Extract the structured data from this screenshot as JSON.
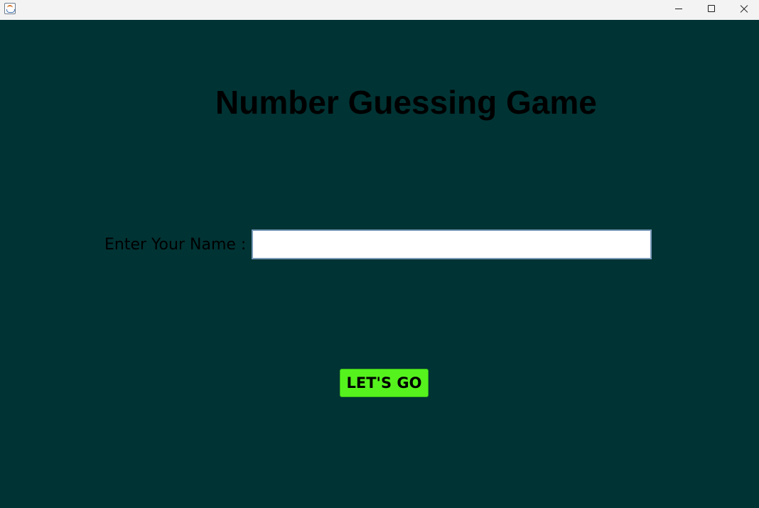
{
  "window": {
    "icon": "java-app-icon",
    "controls": {
      "minimize_icon": "minimize-icon",
      "maximize_icon": "maximize-icon",
      "close_icon": "close-icon"
    }
  },
  "main": {
    "title": "Number Guessing Game",
    "name_label": "Enter Your Name :",
    "name_input_value": "",
    "name_input_placeholder": "",
    "go_button_label": "LET'S GO"
  },
  "colors": {
    "background": "#003334",
    "button": "#55f21e",
    "text": "#000000"
  }
}
